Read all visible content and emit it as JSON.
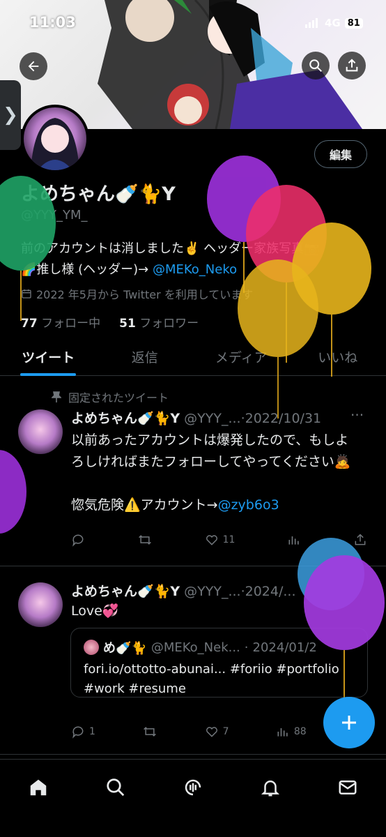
{
  "status_bar": {
    "time": "11:03",
    "network": "4G",
    "battery": "81"
  },
  "header": {
    "back_icon": "arrow-left-icon",
    "search_icon": "search-icon",
    "share_icon": "share-icon"
  },
  "profile": {
    "edit_label": "編集",
    "display_name": "よめちゃん🍼🐈Y",
    "handle": "@YYY_YM_",
    "bio_line1": "前のアカウントは消しました✌️ ヘッダー家族写真📷",
    "bio_line2_prefix": "🌈推し様 (ヘッダー)→ ",
    "bio_link": "@MEKo_Neko",
    "joined": "2022 年5月から Twitter を利用しています",
    "following_count": "77",
    "following_label": "フォロー中",
    "followers_count": "51",
    "followers_label": "フォロワー"
  },
  "tabs": [
    "ツイート",
    "返信",
    "メディア",
    "いいね"
  ],
  "tweets": [
    {
      "pinned_label": "固定されたツイート",
      "name": "よめちゃん🍼🐈Y",
      "handle": "@YYY_...",
      "date": "2022/10/31",
      "body1": "以前あったアカウントは爆発したので、もしよろしければまたフォローしてやってください🙇",
      "body2_prefix": "惚気危険⚠️アカウント→",
      "body2_link": "@zyb6o3",
      "likes": "11"
    },
    {
      "name": "よめちゃん🍼🐈Y",
      "handle": "@YYY_...",
      "date": "2024/...",
      "body": "Love💞",
      "quote": {
        "name": "め🍼🐈",
        "handle": "@MEKo_Nek...",
        "date": "2024/01/2",
        "text": "fori.io/ottotto-abunai... #foriio #portfolio #work #resume"
      },
      "replies": "1",
      "likes": "7",
      "views": "88"
    }
  ],
  "colors": {
    "accent": "#1d9bf0",
    "muted": "#71767b",
    "divider": "#2f3336"
  },
  "bottom_nav": [
    "home-icon",
    "search-icon",
    "spaces-icon",
    "notifications-icon",
    "messages-icon"
  ]
}
